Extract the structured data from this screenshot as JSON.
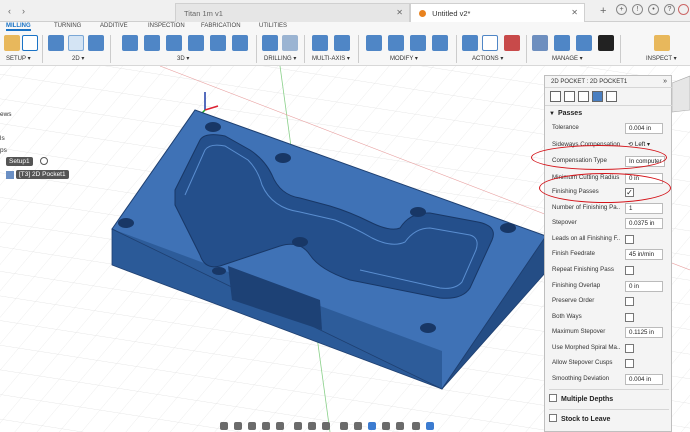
{
  "tabs": {
    "inactive_title": "Titan 1m v1",
    "active_title": "Untitled v2*"
  },
  "workspace_tabs": [
    "MILLING",
    "TURNING",
    "ADDITIVE",
    "INSPECTION",
    "FABRICATION",
    "UTILITIES"
  ],
  "toolbar_groups": [
    "SETUP ▾",
    "2D ▾",
    "3D ▾",
    "DRILLING ▾",
    "MULTI-AXIS ▾",
    "MODIFY ▾",
    "ACTIONS ▾",
    "MANAGE ▾",
    "INSPECT ▾"
  ],
  "browser": {
    "items": [
      "ews",
      "ls",
      "ps"
    ],
    "setup": "Setup1",
    "operation": "[T3] 2D Pocket1"
  },
  "panel": {
    "title": "2D POCKET : 2D POCKET1",
    "passes_section": "Passes",
    "rows": [
      {
        "label": "Tolerance",
        "value": "0.004 in"
      },
      {
        "label": "Sideways Compensation",
        "value": "Left"
      },
      {
        "label": "Compensation Type",
        "value": "In computer"
      },
      {
        "label": "Minimum Cutting Radius",
        "value": "0 in"
      },
      {
        "label": "Finishing Passes",
        "value": "checked"
      },
      {
        "label": "Number of Finishing Pa...",
        "value": "1"
      },
      {
        "label": "Stepover",
        "value": "0.0375 in"
      },
      {
        "label": "Leads on all Finishing F...",
        "value": ""
      },
      {
        "label": "Finish Feedrate",
        "value": "45 in/min"
      },
      {
        "label": "Repeat Finishing Pass",
        "value": ""
      },
      {
        "label": "Finishing Overlap",
        "value": "0 in"
      },
      {
        "label": "Preserve Order",
        "value": ""
      },
      {
        "label": "Both Ways",
        "value": ""
      },
      {
        "label": "Maximum Stepover",
        "value": "0.1125 in"
      },
      {
        "label": "Use Morphed Spiral Ma...",
        "value": ""
      },
      {
        "label": "Allow Stepover Cusps",
        "value": ""
      },
      {
        "label": "Smoothing Deviation",
        "value": "0.004 in"
      }
    ],
    "multiple_depths": "Multiple Depths",
    "stock_to_leave": "Stock to Leave"
  },
  "colors": {
    "part": "#2f63a8",
    "annotation": "#d4141a",
    "accent": "#1a73c6"
  }
}
